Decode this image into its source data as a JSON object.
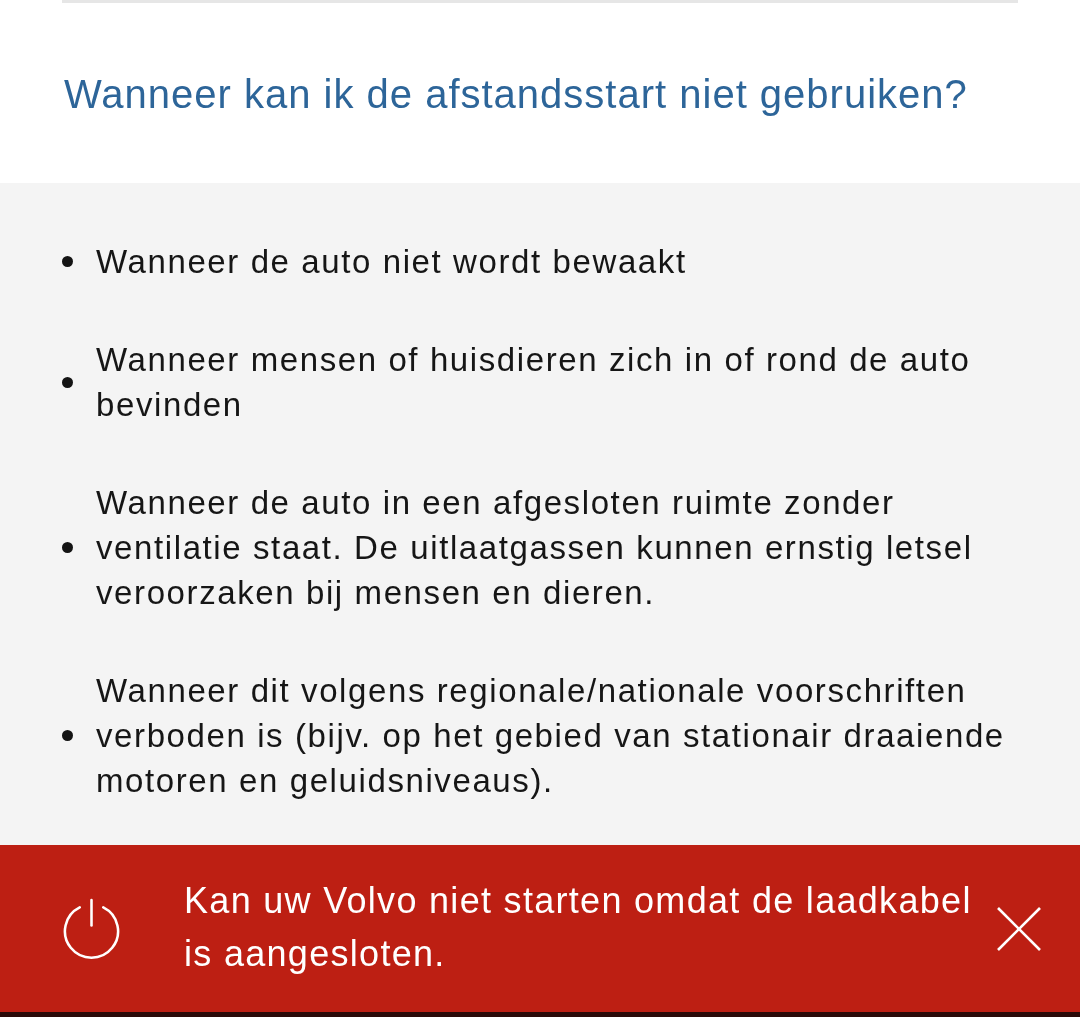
{
  "heading": "Wanneer kan ik de afstandsstart niet gebruiken?",
  "items": [
    "Wanneer de auto niet wordt bewaakt",
    "Wanneer mensen of huisdieren zich in of rond de auto bevinden",
    "Wanneer de auto in een afgesloten ruimte zonder ventilatie staat. De uitlaatgassen kunnen ernstig letsel veroorzaken bij mensen en dieren.",
    "Wanneer dit volgens regionale/nationale voorschriften verboden is (bijv. op het gebied van stationair draaiende motoren en geluidsniveaus)."
  ],
  "notification": {
    "message": "Kan uw Volvo niet starten omdat de laadkabel is aangesloten."
  }
}
